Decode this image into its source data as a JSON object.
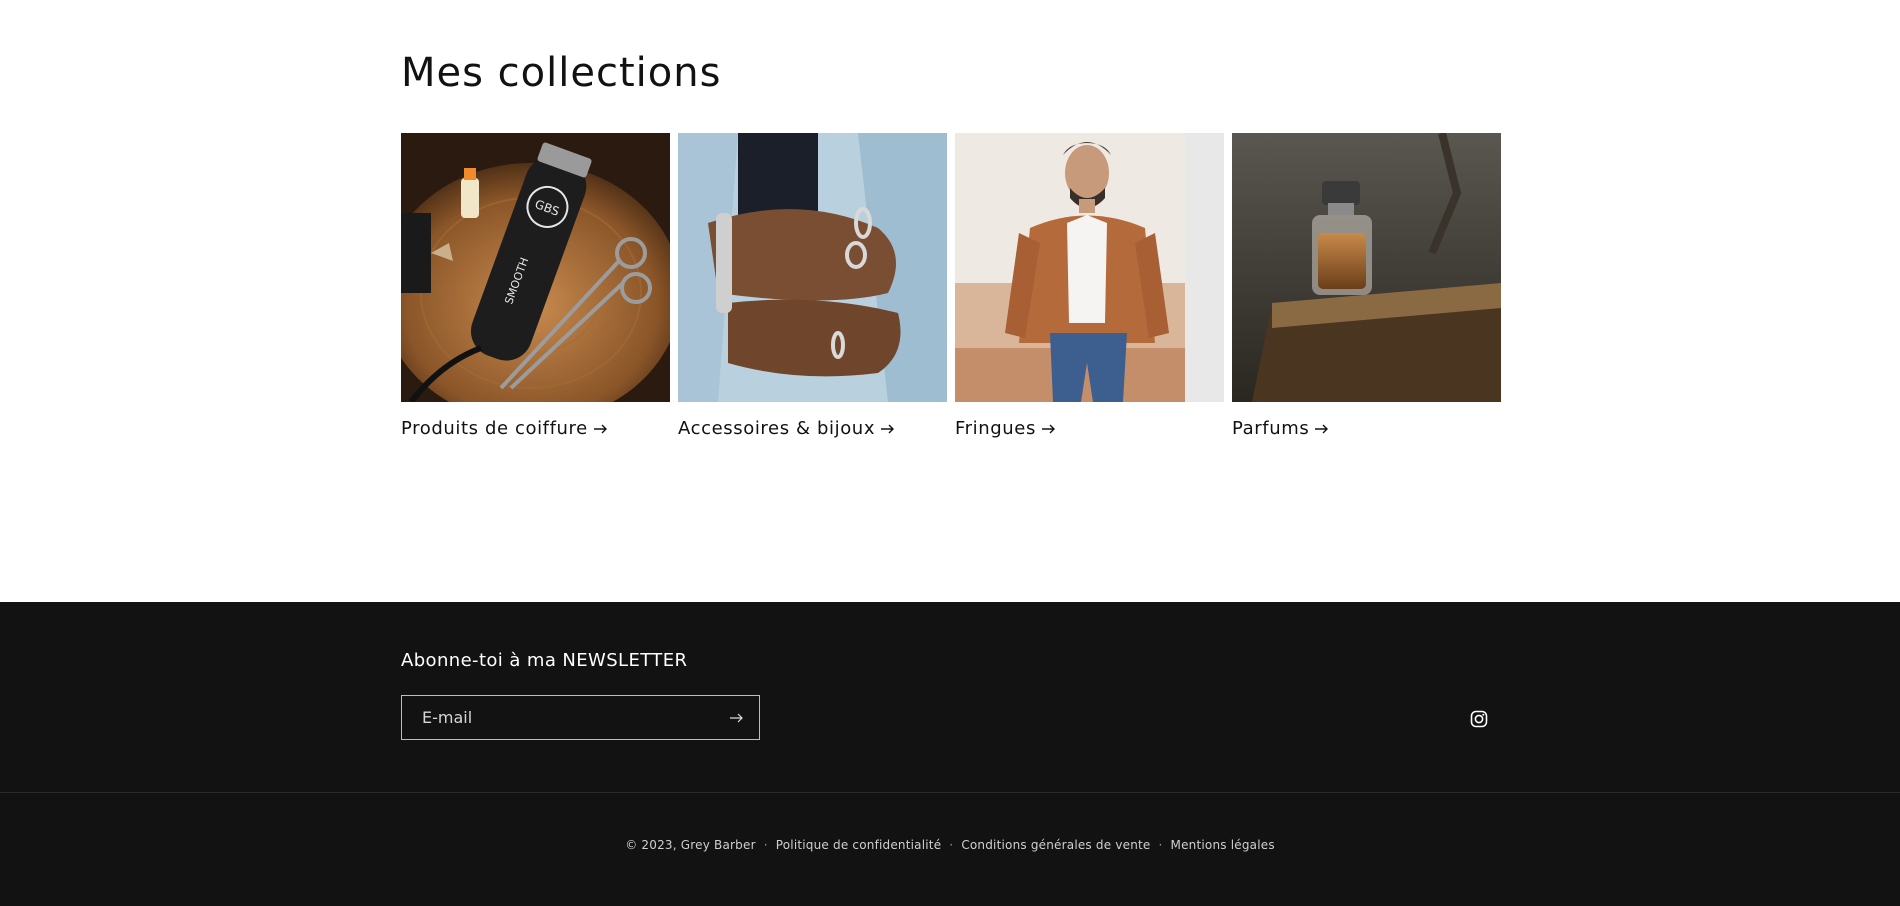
{
  "collections": {
    "title": "Mes collections",
    "items": [
      {
        "label": "Produits de coiffure",
        "icon": "arrow-right-icon"
      },
      {
        "label": "Accessoires & bijoux",
        "icon": "arrow-right-icon"
      },
      {
        "label": "Fringues",
        "icon": "arrow-right-icon"
      },
      {
        "label": "Parfums",
        "icon": "arrow-right-icon"
      }
    ]
  },
  "footer": {
    "newsletter_heading": "Abonne-toi à ma NEWSLETTER",
    "email_placeholder": "E-mail",
    "submit_icon": "arrow-right-icon",
    "social_icon": "instagram-icon",
    "copyright": "© 2023, Grey Barber",
    "separator": "·",
    "links": [
      {
        "label": "Politique de confidentialité"
      },
      {
        "label": "Conditions générales de vente"
      },
      {
        "label": "Mentions légales"
      }
    ]
  },
  "colors": {
    "text": "#121212",
    "footer_bg": "#121212",
    "footer_text": "#ffffff"
  }
}
